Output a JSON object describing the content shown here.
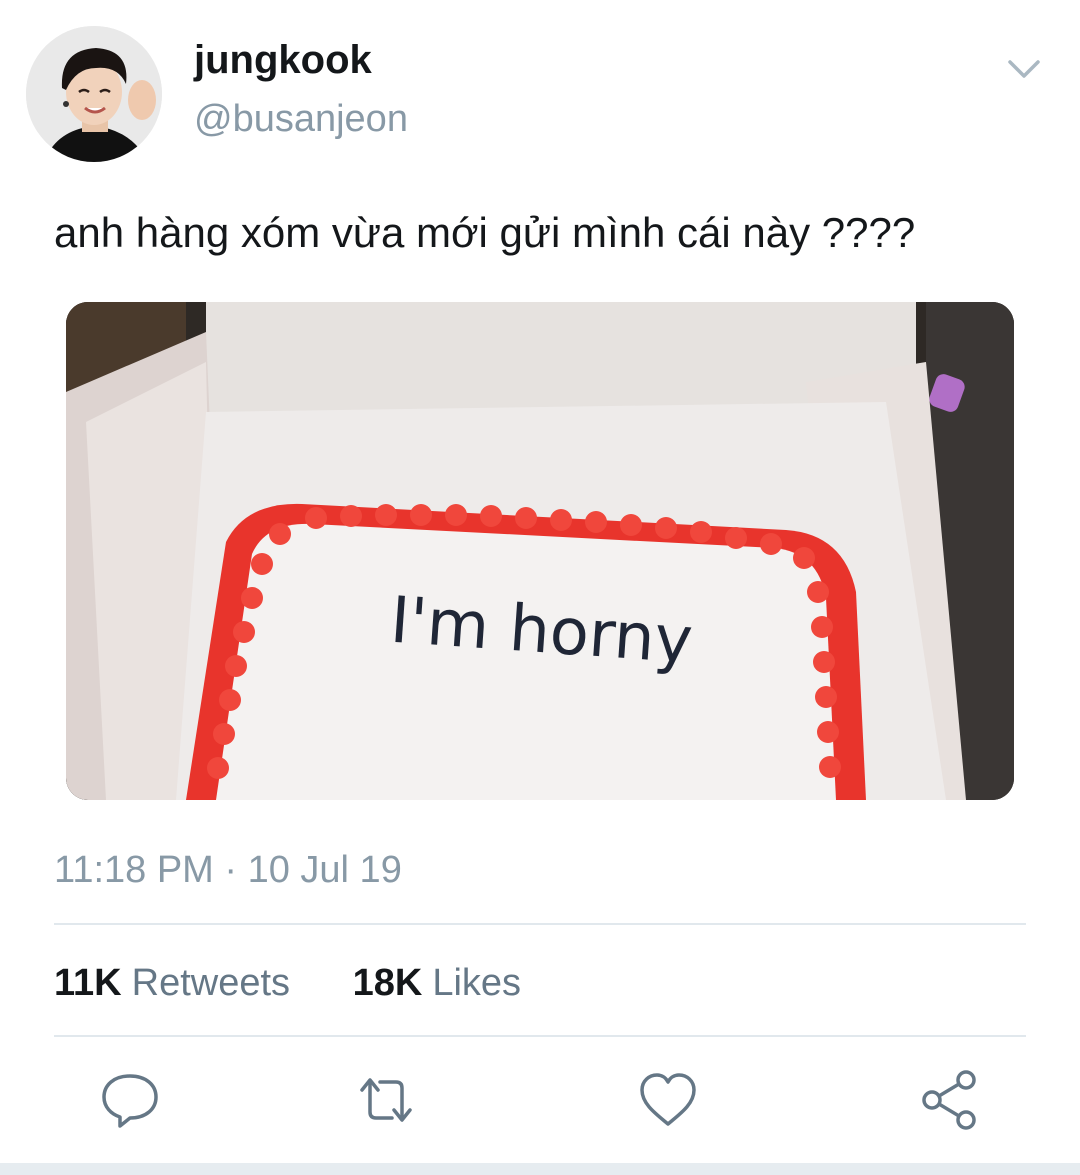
{
  "tweet": {
    "display_name": "jungkook",
    "handle": "@busanjeon",
    "text": "anh hàng xóm vừa mới gửi mình cái này ????",
    "timestamp": "11:18 PM · 10 Jul 19",
    "media": {
      "cake_text": "I'm horny"
    },
    "stats": {
      "retweets_count": "11K",
      "retweets_label": "Retweets",
      "likes_count": "18K",
      "likes_label": "Likes"
    }
  },
  "icons": {
    "more": "chevron-down-icon",
    "reply": "reply-icon",
    "retweet": "retweet-icon",
    "like": "heart-icon",
    "share": "share-icon"
  },
  "colors": {
    "secondary_text": "#8899a6",
    "divider": "#e1e8ed",
    "icon": "#657786",
    "frosting_red": "#e8342c"
  }
}
